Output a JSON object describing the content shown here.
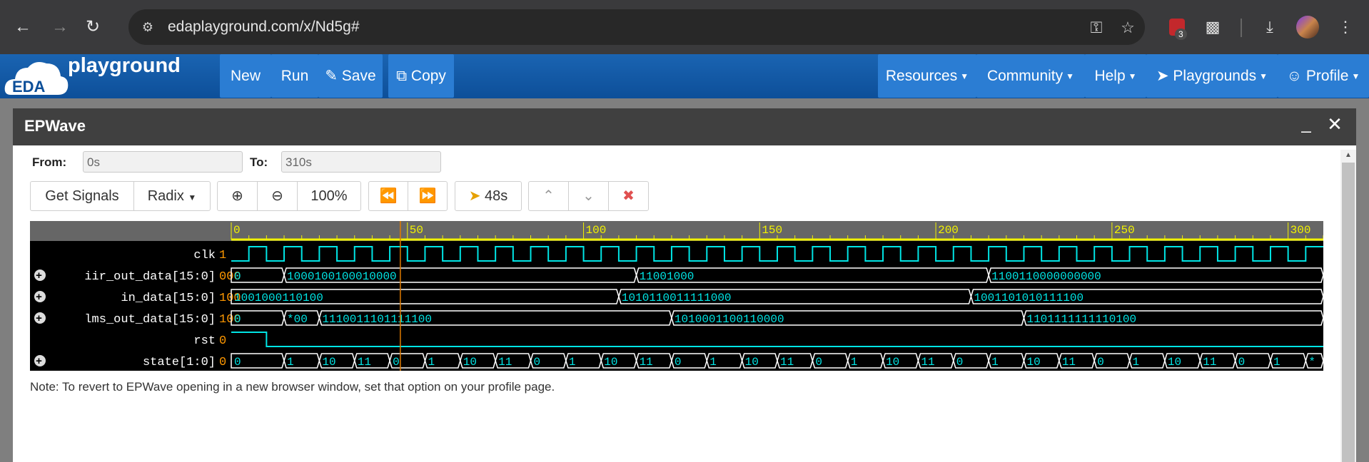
{
  "browser": {
    "url": "edaplayground.com/x/Nd5g#",
    "extension_badge_count": "3",
    "icons": [
      "back-icon",
      "forward-icon",
      "reload-icon",
      "site-settings-icon",
      "key-icon",
      "star-icon",
      "extension-icon",
      "puzzle-icon",
      "download-icon",
      "avatar",
      "menu-icon"
    ]
  },
  "eda_nav": {
    "logo_badge": "EDA",
    "logo_text": "playground",
    "left_buttons": [
      "New",
      "Run",
      "Save",
      "Copy"
    ],
    "right_buttons": [
      "Resources",
      "Community",
      "Help",
      "Playgrounds",
      "Profile"
    ],
    "colors": {
      "bar": "#1258a6",
      "button": "#2b7dd3"
    }
  },
  "epwave": {
    "title": "EPWave",
    "from_label": "From:",
    "from_value": "0s",
    "to_label": "To:",
    "to_value": "310s",
    "toolbar": {
      "get_signals": "Get Signals",
      "radix": "Radix",
      "zoom": "100%",
      "cursor_time": "48s"
    },
    "note": "Note: To revert to EPWave opening in a new browser window, set that option on your profile page.",
    "colors": {
      "wave": "#00e5e5",
      "value": "#ff9800",
      "ruler": "#f2f200",
      "panel_bg": "#000000",
      "marker": "#e07b00"
    }
  },
  "waveform": {
    "time_range": [
      0,
      310
    ],
    "ruler_labels": [
      "0",
      "50",
      "100",
      "150",
      "200",
      "250",
      "300"
    ],
    "ruler_ticks": [
      0,
      50,
      100,
      150,
      200,
      250,
      300
    ],
    "cursor_time": 48,
    "clock_period": 10,
    "clock_start_high": 5,
    "signals": [
      {
        "name": "clk",
        "value": "1",
        "expandable": false,
        "kind": "clock"
      },
      {
        "name": "iir_out_data[15:0]",
        "value": "000",
        "expandable": true,
        "kind": "bus",
        "segments": [
          {
            "t": 0,
            "label": "0"
          },
          {
            "t": 15,
            "label": "1000100100010000"
          },
          {
            "t": 115,
            "label": "11001000"
          },
          {
            "t": 215,
            "label": "1100110000000000"
          }
        ]
      },
      {
        "name": "in_data[15:0]",
        "value": "100",
        "expandable": true,
        "kind": "bus",
        "segments": [
          {
            "t": 0,
            "label": "1001000110100"
          },
          {
            "t": 110,
            "label": "1010110011111000"
          },
          {
            "t": 210,
            "label": "1001101010111100"
          }
        ]
      },
      {
        "name": "lms_out_data[15:0]",
        "value": "100",
        "expandable": true,
        "kind": "bus",
        "segments": [
          {
            "t": 0,
            "label": "0"
          },
          {
            "t": 15,
            "label": "*00"
          },
          {
            "t": 25,
            "label": "1110011101111100"
          },
          {
            "t": 125,
            "label": "1010001100110000"
          },
          {
            "t": 225,
            "label": "1101111111110100"
          }
        ]
      },
      {
        "name": "rst",
        "value": "0",
        "expandable": false,
        "kind": "bit",
        "edges": [
          {
            "t": 0,
            "v": 1
          },
          {
            "t": 10,
            "v": 0
          }
        ]
      },
      {
        "name": "state[1:0]",
        "value": "0",
        "expandable": true,
        "kind": "bus",
        "segments": [
          {
            "t": 0,
            "label": "0"
          },
          {
            "t": 15,
            "label": "1"
          },
          {
            "t": 25,
            "label": "10"
          },
          {
            "t": 35,
            "label": "11"
          },
          {
            "t": 45,
            "label": "0"
          },
          {
            "t": 55,
            "label": "1"
          },
          {
            "t": 65,
            "label": "10"
          },
          {
            "t": 75,
            "label": "11"
          },
          {
            "t": 85,
            "label": "0"
          },
          {
            "t": 95,
            "label": "1"
          },
          {
            "t": 105,
            "label": "10"
          },
          {
            "t": 115,
            "label": "11"
          },
          {
            "t": 125,
            "label": "0"
          },
          {
            "t": 135,
            "label": "1"
          },
          {
            "t": 145,
            "label": "10"
          },
          {
            "t": 155,
            "label": "11"
          },
          {
            "t": 165,
            "label": "0"
          },
          {
            "t": 175,
            "label": "1"
          },
          {
            "t": 185,
            "label": "10"
          },
          {
            "t": 195,
            "label": "11"
          },
          {
            "t": 205,
            "label": "0"
          },
          {
            "t": 215,
            "label": "1"
          },
          {
            "t": 225,
            "label": "10"
          },
          {
            "t": 235,
            "label": "11"
          },
          {
            "t": 245,
            "label": "0"
          },
          {
            "t": 255,
            "label": "1"
          },
          {
            "t": 265,
            "label": "10"
          },
          {
            "t": 275,
            "label": "11"
          },
          {
            "t": 285,
            "label": "0"
          },
          {
            "t": 295,
            "label": "1"
          },
          {
            "t": 305,
            "label": "*"
          }
        ]
      }
    ]
  }
}
